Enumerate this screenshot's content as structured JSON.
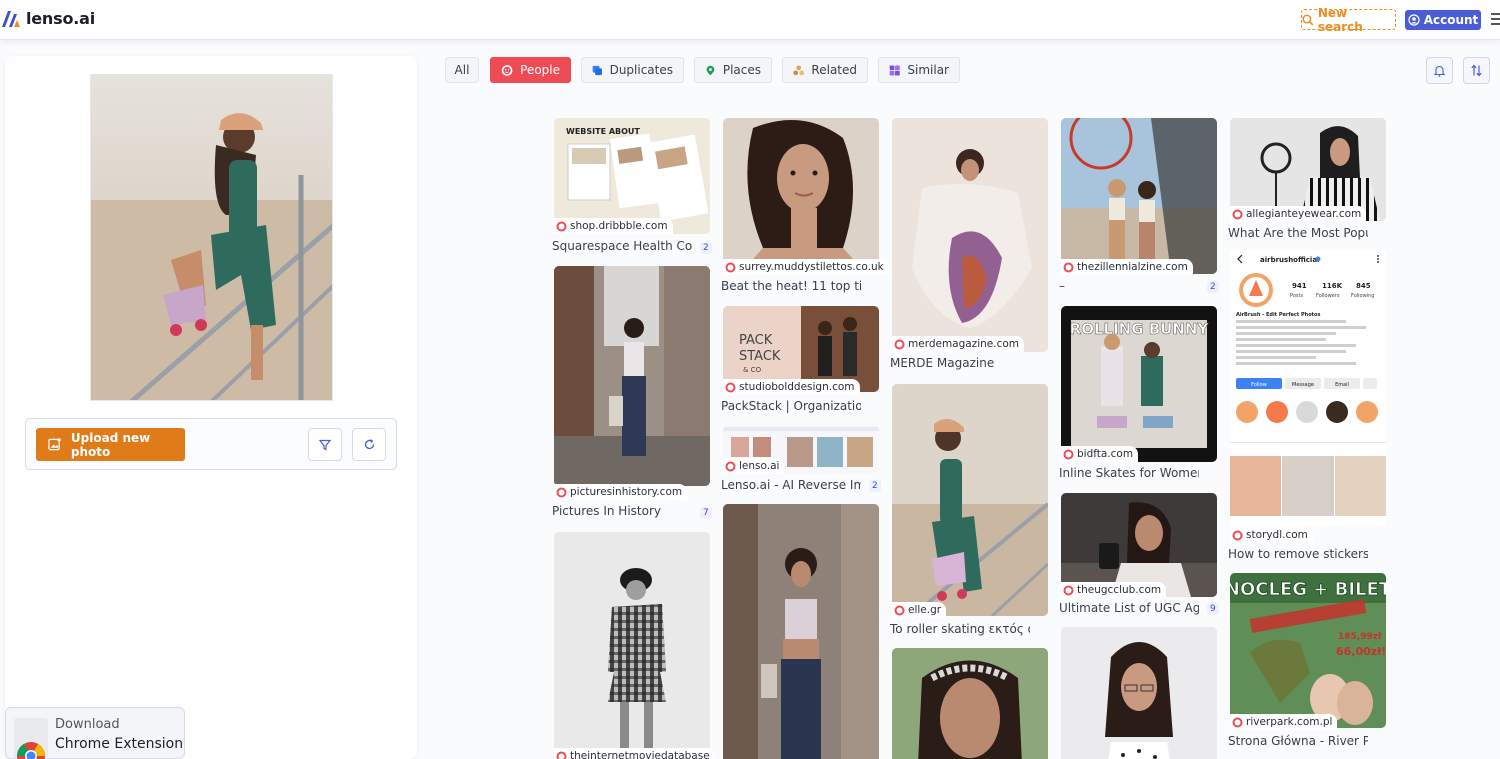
{
  "header": {
    "brand": "lenso.ai",
    "new_search_label": "New search",
    "account_label": "Account"
  },
  "left": {
    "upload_label": "Upload new photo",
    "chrome_line1": "Download",
    "chrome_line2": "Chrome Extension"
  },
  "tabs": [
    {
      "label": "All",
      "icon": "none"
    },
    {
      "label": "People",
      "icon": "face-icon"
    },
    {
      "label": "Duplicates",
      "icon": "duplicates-icon"
    },
    {
      "label": "Places",
      "icon": "pin-icon"
    },
    {
      "label": "Related",
      "icon": "related-icon"
    },
    {
      "label": "Similar",
      "icon": "grid-icon"
    }
  ],
  "results": [
    {
      "source": "shop.dribbble.com",
      "title": "Squarespace Health Coa…",
      "count": "2"
    },
    {
      "source": "picturesinhistory.com",
      "title": "Pictures In History",
      "count": "7"
    },
    {
      "source": "theinternetmoviedatabase",
      "title": "",
      "count": ""
    },
    {
      "source": "surrey.muddystilettos.co.uk",
      "title": "Beat the heat! 11 top tips fo…",
      "count": ""
    },
    {
      "source": "studiobolddesign.com",
      "title": "PackStack | Organization S…",
      "count": ""
    },
    {
      "source": "lenso.ai",
      "title": "Lenso.ai - AI Reverse Im…",
      "count": "2"
    },
    {
      "source": "",
      "title": "",
      "count": ""
    },
    {
      "source": "merdemagazine.com",
      "title": "MERDE Magazine",
      "count": ""
    },
    {
      "source": "elle.gr",
      "title": "To roller skating εκτός από …",
      "count": ""
    },
    {
      "source": "",
      "title": "",
      "count": ""
    },
    {
      "source": "thezillennialzine.com",
      "title": "–",
      "count": "2"
    },
    {
      "source": "bidfta.com",
      "title": "Inline Skates for Women Gi…",
      "count": ""
    },
    {
      "source": "theugcclub.com",
      "title": "Ultimate List of UGC Age…",
      "count": "9"
    },
    {
      "source": "",
      "title": "",
      "count": ""
    },
    {
      "source": "allegianteyewear.com",
      "title": "What Are the Most Popular …",
      "count": ""
    },
    {
      "source": "storydl.com",
      "title": "How to remove stickers fro…",
      "count": ""
    },
    {
      "source": "riverpark.com.pl",
      "title": "Strona Główna - River Park …",
      "count": ""
    }
  ],
  "thumb_text": {
    "website_about": "WEBSITE ABOUT",
    "pack_stack_1": "PACK",
    "pack_stack_2": "STACK",
    "pack_stack_3": "& CO",
    "rolling_bunny": "ROLLING BUNNY",
    "airbrush_name": "airbrushofficial",
    "airbrush_posts": "941",
    "airbrush_followers": "116K",
    "airbrush_following": "845",
    "airbrush_posts_label": "Posts",
    "airbrush_followers_label": "Followers",
    "airbrush_following_label": "Following",
    "airbrush_bio_title": "AirBrush - Edit Perfect Photos",
    "airbrush_follow": "Follow",
    "airbrush_message": "Message",
    "airbrush_email": "Email",
    "nocleg": "NOCLEG + BILET",
    "price_old": "185,99zł",
    "price_new": "66,00zł!"
  },
  "colors": {
    "accent_orange": "#e07b1a",
    "people_tab_red": "#ef4b55",
    "account_blue": "#4a5dd6"
  }
}
